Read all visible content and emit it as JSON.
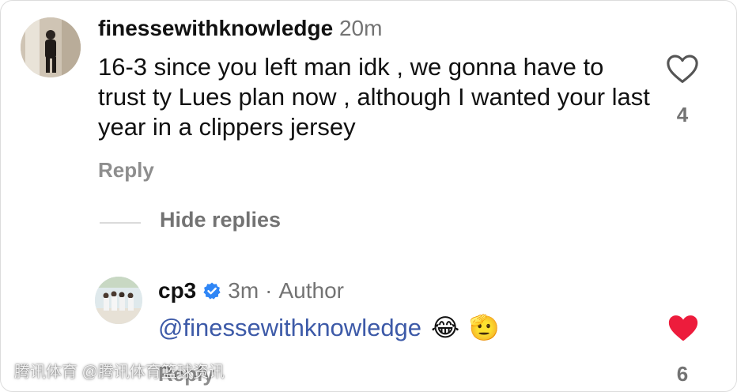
{
  "comment": {
    "username": "finessewithknowledge",
    "time": "20m",
    "text": "16-3 since you left man idk , we gonna have to trust ty Lues plan now , although I wanted your last year in a clippers jersey",
    "reply_label": "Reply",
    "like_count": "4",
    "liked": false
  },
  "replies_toggle": {
    "label": "Hide replies"
  },
  "reply": {
    "username": "cp3",
    "time": "3m",
    "separator": "·",
    "role": "Author",
    "mention": "@finessewithknowledge",
    "emojis": [
      "😂",
      "🫡"
    ],
    "reply_label": "Reply",
    "like_count": "6",
    "liked": true
  },
  "watermark": "腾讯体育 @腾讯体育篮球资讯",
  "colors": {
    "liked_heart": "#ed1c3c",
    "mention": "#3d5aa8",
    "verified_badge": "#2f86f6",
    "muted_text": "#737373"
  }
}
